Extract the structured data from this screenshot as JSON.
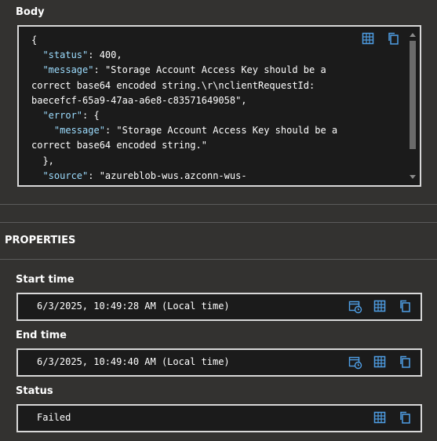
{
  "body": {
    "label": "Body",
    "json_lines": [
      {
        "indent": "",
        "text": "{"
      },
      {
        "indent": "  ",
        "key": "\"status\"",
        "sep": ": ",
        "value": "400,"
      },
      {
        "indent": "  ",
        "key": "\"message\"",
        "sep": ": ",
        "value": "\"Storage Account Access Key should be a"
      },
      {
        "indent": "",
        "text": "correct base64 encoded string.\\r\\nclientRequestId:"
      },
      {
        "indent": "",
        "text": "baecefcf-65a9-47aa-a6e8-c83571649058\","
      },
      {
        "indent": "  ",
        "key": "\"error\"",
        "sep": ": ",
        "value": "{"
      },
      {
        "indent": "    ",
        "key": "\"message\"",
        "sep": ": ",
        "value": "\"Storage Account Access Key should be a"
      },
      {
        "indent": "",
        "text": "correct base64 encoded string.\""
      },
      {
        "indent": "  ",
        "text": "},"
      },
      {
        "indent": "  ",
        "key": "\"source\"",
        "sep": ": ",
        "value": "\"azureblob-wus.azconn-wus-"
      }
    ]
  },
  "properties": {
    "title": "PROPERTIES",
    "start_time": {
      "label": "Start time",
      "value": "6/3/2025, 10:49:28 AM (Local time)"
    },
    "end_time": {
      "label": "End time",
      "value": "6/3/2025, 10:49:40 AM (Local time)"
    },
    "status": {
      "label": "Status",
      "value": "Failed"
    }
  },
  "colors": {
    "accent": "#4f9fe6",
    "background": "#333230",
    "field": "#1b1b1b"
  },
  "icons": [
    "table-icon",
    "copy-icon",
    "calendar-clock-icon"
  ]
}
